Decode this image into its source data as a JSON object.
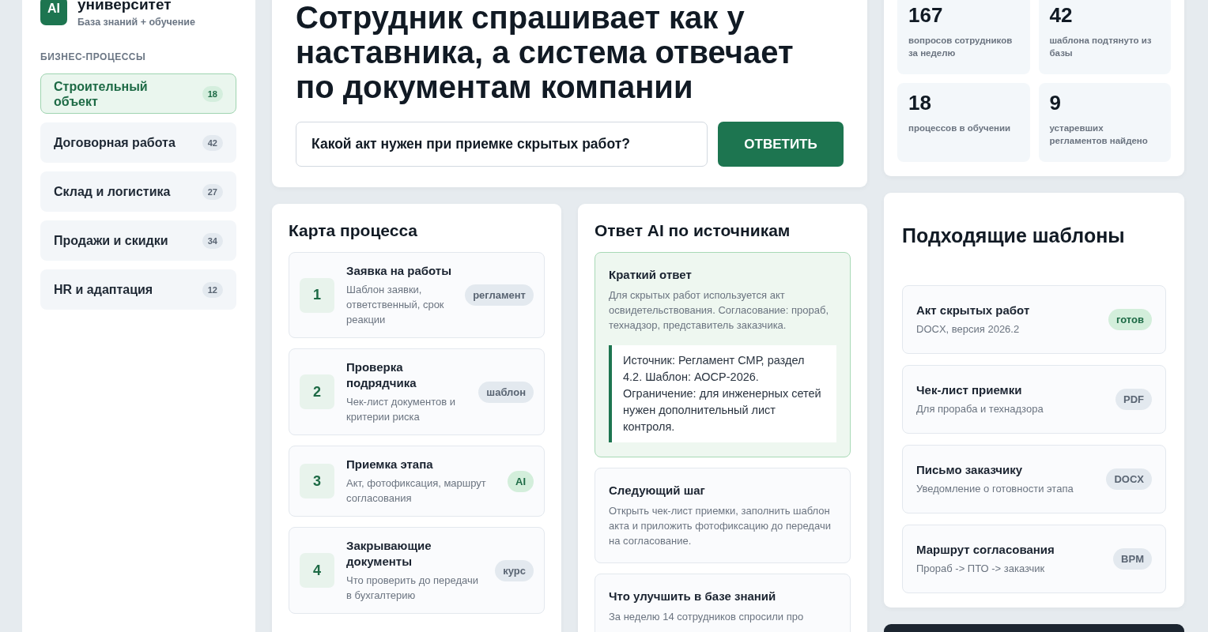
{
  "brand": {
    "logo": "AI",
    "title": "университет",
    "subtitle": "База знаний + обучение"
  },
  "sidebar": {
    "section": "БИЗНЕС-ПРОЦЕССЫ",
    "items": [
      {
        "label": "Строительный объект",
        "count": "18",
        "selected": true
      },
      {
        "label": "Договорная работа",
        "count": "42",
        "selected": false
      },
      {
        "label": "Склад и логистика",
        "count": "27",
        "selected": false
      },
      {
        "label": "Продажи и скидки",
        "count": "34",
        "selected": false
      },
      {
        "label": "HR и адаптация",
        "count": "12",
        "selected": false
      }
    ]
  },
  "hero": {
    "title": "Сотрудник спрашивает как у наставника, а система отвечает по документам компании",
    "question": "Какой акт нужен при приемке скрытых работ?",
    "button": "ОТВЕТИТЬ"
  },
  "stats": [
    {
      "value": "167",
      "label": "вопросов сотрудников за неделю"
    },
    {
      "value": "42",
      "label": "шаблона подтянуто из базы"
    },
    {
      "value": "18",
      "label": "процессов в обучении"
    },
    {
      "value": "9",
      "label": "устаревших регламентов найдено"
    }
  ],
  "process": {
    "title": "Карта процесса",
    "steps": [
      {
        "number": "1",
        "title": "Заявка на работы",
        "text": "Шаблон заявки, ответственный, срок реакции",
        "tag": "регламент",
        "highlighted": false
      },
      {
        "number": "2",
        "title": "Проверка подрядчика",
        "text": "Чек-лист документов и критерии риска",
        "tag": "шаблон",
        "highlighted": false
      },
      {
        "number": "3",
        "title": "Приемка этапа",
        "text": "Акт, фотофиксация, маршрут согласования",
        "tag": "AI",
        "highlighted": true
      },
      {
        "number": "4",
        "title": "Закрывающие документы",
        "text": "Что проверить до передачи в бухгалтерию",
        "tag": "курс",
        "highlighted": false
      }
    ]
  },
  "answer": {
    "title": "Ответ AI по источникам",
    "blocks": [
      {
        "kind": "summary",
        "title": "Краткий ответ",
        "text": "Для скрытых работ используется акт освидетельствования. Согласование: прораб, технадзор, представитель заказчика.",
        "source": "Источник: Регламент СМР, раздел 4.2. Шаблон: АОСР-2026. Ограничение: для инженерных сетей нужен дополнительный лист контроля."
      },
      {
        "kind": "plain",
        "title": "Следующий шаг",
        "text": "Открыть чек-лист приемки, заполнить шаблон акта и приложить фотофиксацию до передачи на согласование."
      },
      {
        "kind": "plain",
        "title": "Что улучшить в базе знаний",
        "text": "За неделю 14 сотрудников спросили про"
      }
    ]
  },
  "templates": {
    "title": "Подходящие шаблоны",
    "items": [
      {
        "title": "Акт скрытых работ",
        "text": "DOCX, версия 2026.2",
        "tag": "готов",
        "highlighted": true
      },
      {
        "title": "Чек-лист приемки",
        "text": "Для прораба и технадзора",
        "tag": "PDF",
        "highlighted": false
      },
      {
        "title": "Письмо заказчику",
        "text": "Уведомление о готовности этапа",
        "tag": "DOCX",
        "highlighted": false
      },
      {
        "title": "Маршрут согласования",
        "text": "Прораб -> ПТО -> заказчик",
        "tag": "BPM",
        "highlighted": false
      }
    ]
  }
}
